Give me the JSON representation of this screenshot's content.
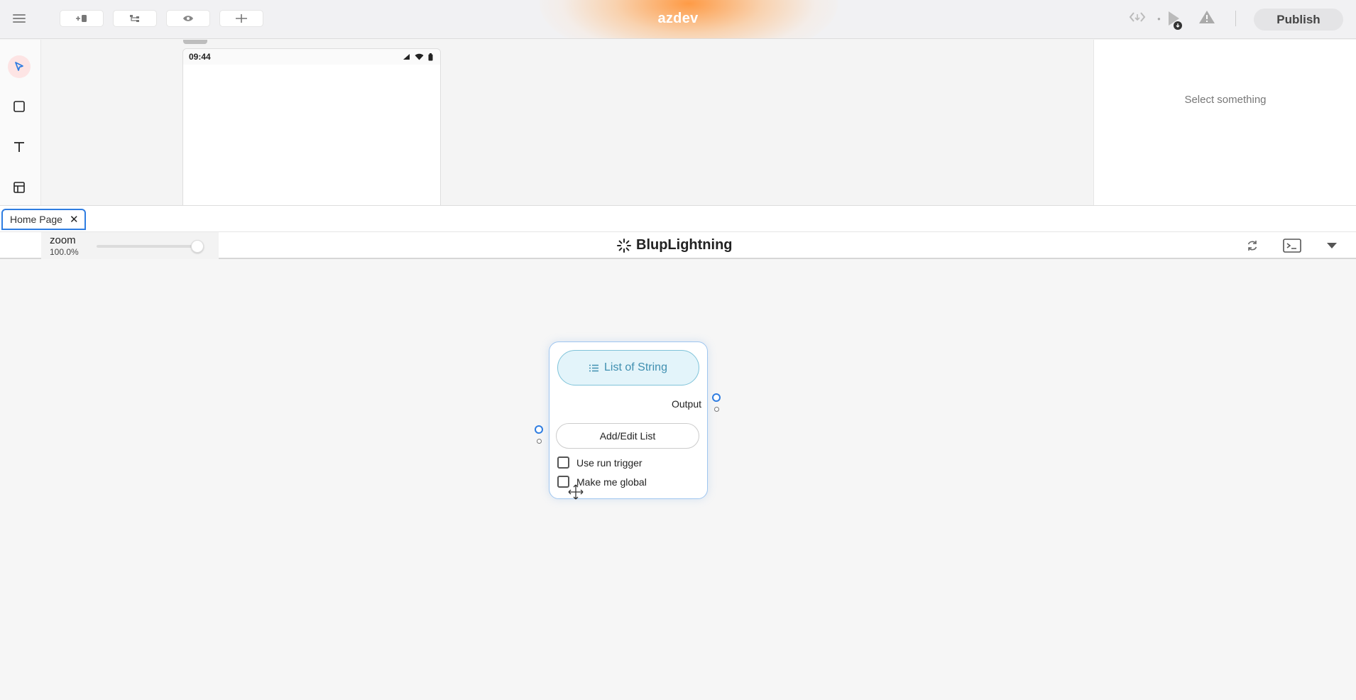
{
  "topbar": {
    "brand": "azdev",
    "publish_label": "Publish",
    "toolbar_buttons": [
      "add-page-icon",
      "tree-icon",
      "eye-icon",
      "connector-icon"
    ]
  },
  "left_tools": [
    "pointer-icon",
    "rectangle-icon",
    "text-icon",
    "layout-icon"
  ],
  "phone": {
    "time": "09:44"
  },
  "right_panel": {
    "empty_message": "Select something"
  },
  "tabs": [
    {
      "label": "Home Page",
      "active": true
    }
  ],
  "logic_toolbar": {
    "zoom_label": "zoom",
    "zoom_value": "100.0%",
    "zoom_level": 1.0,
    "brand": "BlupLightning"
  },
  "node": {
    "title": "List of String",
    "output_label": "Output",
    "button_label": "Add/Edit List",
    "checkboxes": [
      {
        "label": "Use run trigger",
        "checked": false
      },
      {
        "label": "Make me global",
        "checked": false
      }
    ]
  },
  "colors": {
    "accent": "#2f7de1",
    "node_title_bg": "#e3f4fa",
    "node_title_text": "#3f8fb0",
    "active_tool_bg": "#fde4e4"
  }
}
